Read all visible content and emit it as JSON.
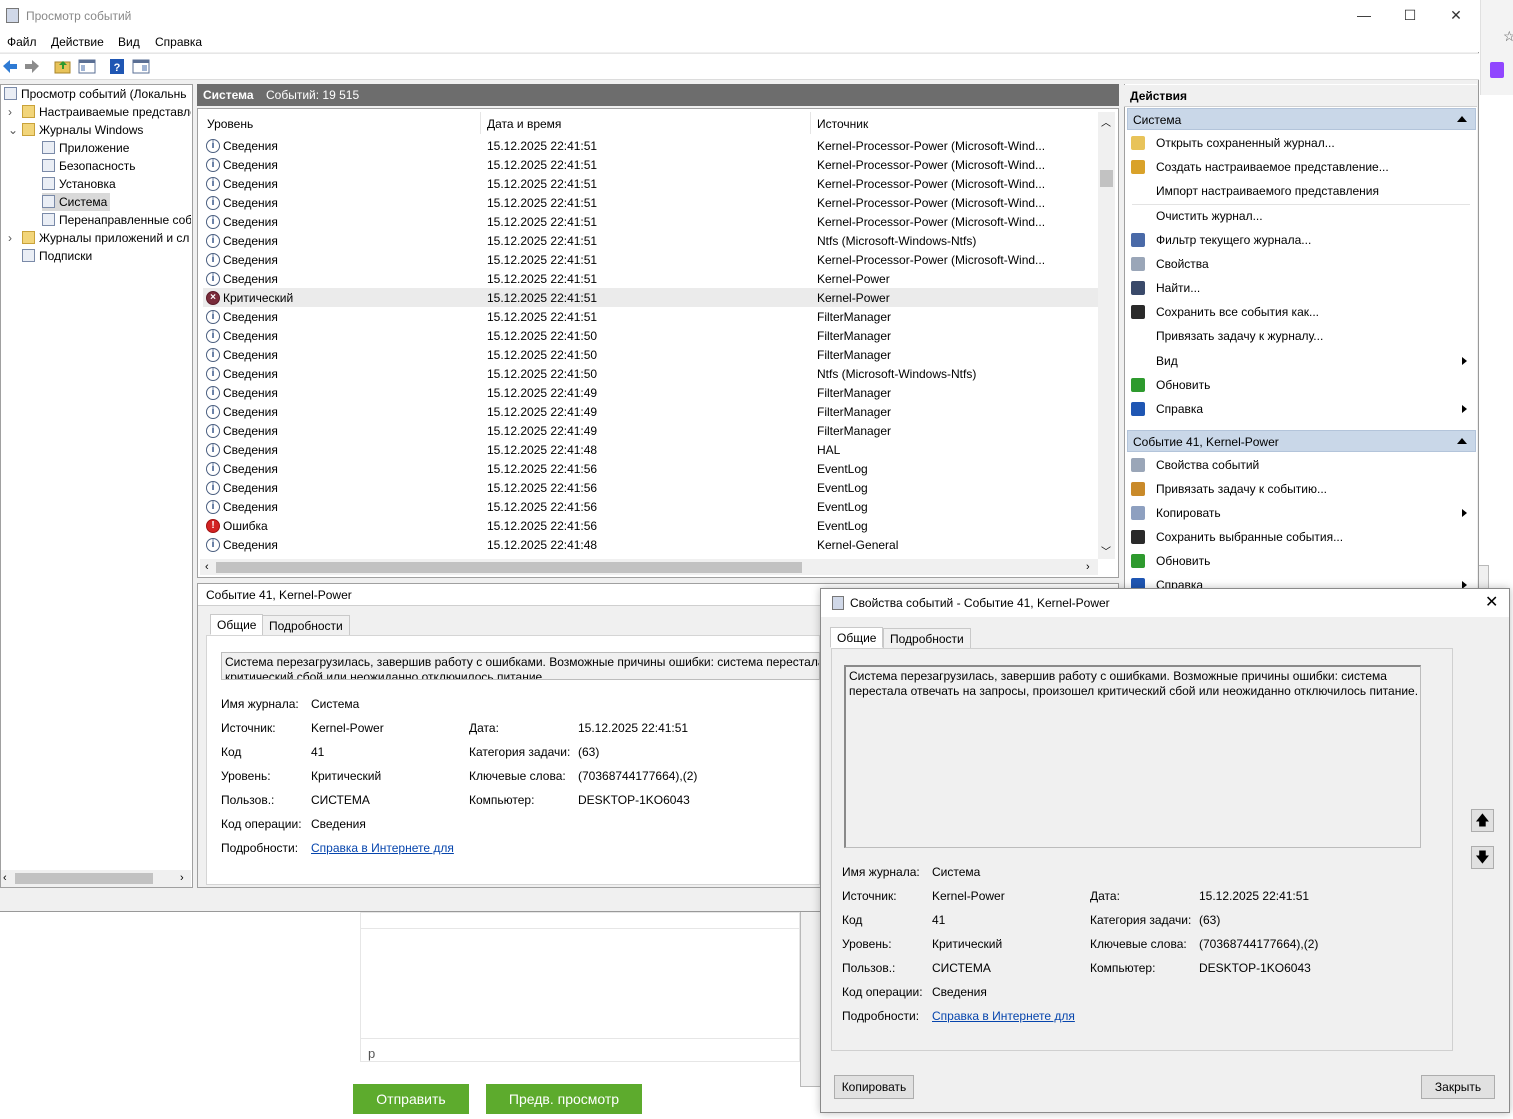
{
  "window": {
    "title": "Просмотр событий",
    "minimize_glyph": "—",
    "maximize_glyph": "☐",
    "close_glyph": "✕"
  },
  "menu": [
    "Файл",
    "Действие",
    "Вид",
    "Справка"
  ],
  "toolbar_icons": [
    "back-icon",
    "forward-icon",
    "folder-up-icon",
    "show-hide-tree-icon",
    "help-icon",
    "show-action-pane-icon"
  ],
  "tree": {
    "items": [
      {
        "label": "Просмотр событий (Локальнь",
        "indent": 0,
        "expander": "",
        "icon": "event-viewer-icon"
      },
      {
        "label": "Настраиваемые представле",
        "indent": 1,
        "expander": "›",
        "icon": "folder-icon"
      },
      {
        "label": "Журналы Windows",
        "indent": 1,
        "expander": "⌄",
        "icon": "folder-icon"
      },
      {
        "label": "Приложение",
        "indent": 2,
        "expander": "",
        "icon": "log-icon"
      },
      {
        "label": "Безопасность",
        "indent": 2,
        "expander": "",
        "icon": "log-icon"
      },
      {
        "label": "Установка",
        "indent": 2,
        "expander": "",
        "icon": "log-icon"
      },
      {
        "label": "Система",
        "indent": 2,
        "expander": "",
        "icon": "log-icon",
        "selected": true
      },
      {
        "label": "Перенаправленные соб",
        "indent": 2,
        "expander": "",
        "icon": "log-icon"
      },
      {
        "label": "Журналы приложений и сл",
        "indent": 1,
        "expander": "›",
        "icon": "folder-icon"
      },
      {
        "label": "Подписки",
        "indent": 1,
        "expander": "",
        "icon": "subscriptions-icon"
      }
    ]
  },
  "center": {
    "log_name": "Система",
    "count_label": "Событий: 19 515",
    "columns": [
      "Уровень",
      "Дата и время",
      "Источник"
    ],
    "rows": [
      {
        "level": "Сведения",
        "type": "info",
        "date": "15.12.2025 22:41:51",
        "source": "Kernel-Processor-Power (Microsoft-Wind..."
      },
      {
        "level": "Сведения",
        "type": "info",
        "date": "15.12.2025 22:41:51",
        "source": "Kernel-Processor-Power (Microsoft-Wind..."
      },
      {
        "level": "Сведения",
        "type": "info",
        "date": "15.12.2025 22:41:51",
        "source": "Kernel-Processor-Power (Microsoft-Wind..."
      },
      {
        "level": "Сведения",
        "type": "info",
        "date": "15.12.2025 22:41:51",
        "source": "Kernel-Processor-Power (Microsoft-Wind..."
      },
      {
        "level": "Сведения",
        "type": "info",
        "date": "15.12.2025 22:41:51",
        "source": "Kernel-Processor-Power (Microsoft-Wind..."
      },
      {
        "level": "Сведения",
        "type": "info",
        "date": "15.12.2025 22:41:51",
        "source": "Ntfs (Microsoft-Windows-Ntfs)"
      },
      {
        "level": "Сведения",
        "type": "info",
        "date": "15.12.2025 22:41:51",
        "source": "Kernel-Processor-Power (Microsoft-Wind..."
      },
      {
        "level": "Сведения",
        "type": "info",
        "date": "15.12.2025 22:41:51",
        "source": "Kernel-Power"
      },
      {
        "level": "Критический",
        "type": "critical",
        "date": "15.12.2025 22:41:51",
        "source": "Kernel-Power",
        "highlighted": true
      },
      {
        "level": "Сведения",
        "type": "info",
        "date": "15.12.2025 22:41:51",
        "source": "FilterManager"
      },
      {
        "level": "Сведения",
        "type": "info",
        "date": "15.12.2025 22:41:50",
        "source": "FilterManager"
      },
      {
        "level": "Сведения",
        "type": "info",
        "date": "15.12.2025 22:41:50",
        "source": "FilterManager"
      },
      {
        "level": "Сведения",
        "type": "info",
        "date": "15.12.2025 22:41:50",
        "source": "Ntfs (Microsoft-Windows-Ntfs)"
      },
      {
        "level": "Сведения",
        "type": "info",
        "date": "15.12.2025 22:41:49",
        "source": "FilterManager"
      },
      {
        "level": "Сведения",
        "type": "info",
        "date": "15.12.2025 22:41:49",
        "source": "FilterManager"
      },
      {
        "level": "Сведения",
        "type": "info",
        "date": "15.12.2025 22:41:49",
        "source": "FilterManager"
      },
      {
        "level": "Сведения",
        "type": "info",
        "date": "15.12.2025 22:41:48",
        "source": "HAL"
      },
      {
        "level": "Сведения",
        "type": "info",
        "date": "15.12.2025 22:41:56",
        "source": "EventLog"
      },
      {
        "level": "Сведения",
        "type": "info",
        "date": "15.12.2025 22:41:56",
        "source": "EventLog"
      },
      {
        "level": "Сведения",
        "type": "info",
        "date": "15.12.2025 22:41:56",
        "source": "EventLog"
      },
      {
        "level": "Ошибка",
        "type": "error",
        "date": "15.12.2025 22:41:56",
        "source": "EventLog"
      },
      {
        "level": "Сведения",
        "type": "info",
        "date": "15.12.2025 22:41:48",
        "source": "Kernel-General"
      }
    ]
  },
  "detail": {
    "title": "Событие 41, Kernel-Power",
    "tabs": [
      "Общие",
      "Подробности"
    ],
    "message_line1": "Система перезагрузилась, завершив работу с ошибками. Возможные причины ошибки: система перестала",
    "message_line2": "критический сбой или неожиданно отключилось питание.",
    "fields": {
      "log_label": "Имя журнала:",
      "log_value": "Система",
      "source_label": "Источник:",
      "source_value": "Kernel-Power",
      "date_label": "Дата:",
      "date_value": "15.12.2025 22:41:51",
      "code_label": "Код",
      "code_value": "41",
      "task_label": "Категория задачи:",
      "task_value": "(63)",
      "level_label": "Уровень:",
      "level_value": "Критический",
      "keywords_label": "Ключевые слова:",
      "keywords_value": "(70368744177664),(2)",
      "user_label": "Пользов.:",
      "user_value": "СИСТЕМА",
      "computer_label": "Компьютер:",
      "computer_value": "DESKTOP-1KO6043",
      "opcode_label": "Код операции:",
      "opcode_value": "Сведения",
      "more_label": "Подробности:",
      "more_link": "Справка в Интернете для "
    }
  },
  "actions": {
    "title": "Действия",
    "section1": "Система",
    "items1": [
      {
        "label": "Открыть сохраненный журнал...",
        "icon": "open-folder-icon"
      },
      {
        "label": "Создать настраиваемое представление...",
        "icon": "filter-create-icon"
      },
      {
        "label": "Импорт настраиваемого представления",
        "icon": ""
      },
      {
        "label": "Очистить журнал...",
        "icon": ""
      },
      {
        "label": "Фильтр текущего журнала...",
        "icon": "filter-icon"
      },
      {
        "label": "Свойства",
        "icon": "properties-icon"
      },
      {
        "label": "Найти...",
        "icon": "binoculars-icon"
      },
      {
        "label": "Сохранить все события как...",
        "icon": "save-icon"
      },
      {
        "label": "Привязать задачу к журналу...",
        "icon": ""
      },
      {
        "label": "Вид",
        "icon": "",
        "submenu": true
      },
      {
        "label": "Обновить",
        "icon": "refresh-icon"
      },
      {
        "label": "Справка",
        "icon": "help-icon",
        "submenu": true
      }
    ],
    "section2": "Событие 41, Kernel-Power",
    "items2": [
      {
        "label": "Свойства событий",
        "icon": "event-properties-icon"
      },
      {
        "label": "Привязать задачу к событию...",
        "icon": "task-icon"
      },
      {
        "label": "Копировать",
        "icon": "copy-icon",
        "submenu": true
      },
      {
        "label": "Сохранить выбранные события...",
        "icon": "save-icon"
      },
      {
        "label": "Обновить",
        "icon": "refresh-icon"
      },
      {
        "label": "Справка",
        "icon": "help-icon",
        "submenu": true
      }
    ]
  },
  "dialog": {
    "title": "Свойства событий - Событие 41, Kernel-Power",
    "tabs": [
      "Общие",
      "Подробности"
    ],
    "message_line1": "Система перезагрузилась, завершив работу с ошибками. Возможные причины ошибки: система",
    "message_line2": "перестала отвечать на запросы, произошел критический сбой или неожиданно отключилось питание.",
    "copy_button": "Копировать",
    "close_button": "Закрыть",
    "up_glyph": "🡅",
    "down_glyph": "🡇"
  },
  "background": {
    "send_button": "Отправить",
    "preview_button": "Предв. просмотр",
    "input_text": "p"
  },
  "colors": {
    "section_header": "#c9d7e8",
    "center_header": "#6d6d6d",
    "send_green": "#5dab2d",
    "link": "#0645ad"
  }
}
